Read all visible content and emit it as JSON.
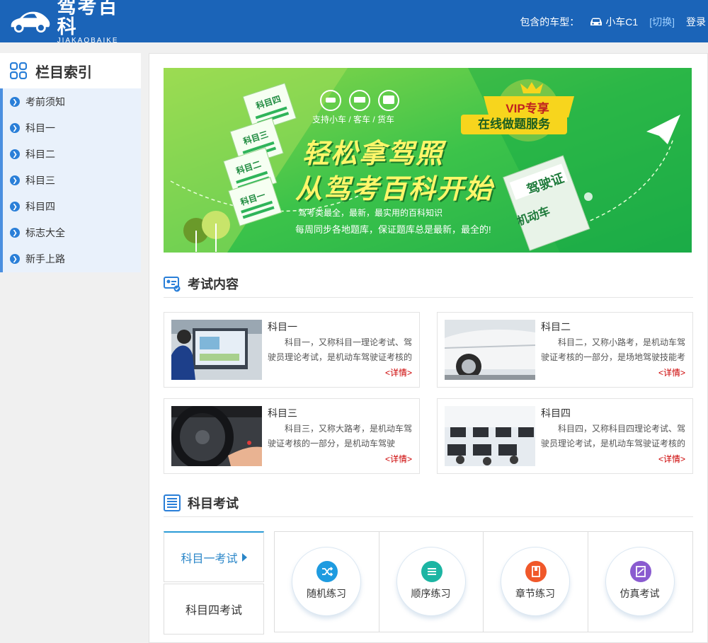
{
  "header": {
    "logo_title": "驾考百科",
    "logo_sub": "JIAKAOBAIKE",
    "car_type_label": "包含的车型：",
    "car_type_value": "小车C1",
    "switch_label": "[切换]",
    "login_label": "登录"
  },
  "sidebar": {
    "title": "栏目索引",
    "items": [
      {
        "label": "考前须知"
      },
      {
        "label": "科目一"
      },
      {
        "label": "科目二"
      },
      {
        "label": "科目三"
      },
      {
        "label": "科目四"
      },
      {
        "label": "标志大全"
      },
      {
        "label": "新手上路"
      }
    ]
  },
  "banner": {
    "support": "支持小车 / 客车 / 货车",
    "line1": "轻松拿驾照",
    "line2": "从驾考百科开始",
    "desc1": "驾考类最全，最新，最实用的百科知识",
    "desc2": "每周同步各地题库，保证题库总是最新，最全的!",
    "vip": "VIP专享",
    "online": "在线做题服务",
    "tickets": [
      "科目四",
      "科目三",
      "科目二",
      "科目一"
    ],
    "license_a": "驾驶证",
    "license_b": "机动车"
  },
  "exam_section": {
    "title": "考试内容",
    "cards": [
      {
        "title": "科目一",
        "desc": "科目一，又称科目一理论考试、驾驶员理论考试，是机动车驾驶证考核的",
        "more": "<详情>"
      },
      {
        "title": "科目二",
        "desc": "科目二，又称小路考，是机动车驾驶证考核的一部分，是场地驾驶技能考",
        "more": "<详情>"
      },
      {
        "title": "科目三",
        "desc": "科目三，又称大路考，是机动车驾驶证考核的一部分，是机动车驾驶",
        "more": "<详情>"
      },
      {
        "title": "科目四",
        "desc": "科目四，又称科目四理论考试、驾驶员理论考试，是机动车驾驶证考核的",
        "more": "<详情>"
      }
    ]
  },
  "subject_section": {
    "title": "科目考试",
    "tabs": [
      {
        "label": "科目一考试",
        "active": true
      },
      {
        "label": "科目四考试",
        "active": false
      }
    ],
    "practices": [
      {
        "label": "随机练习",
        "icon": "shuffle-icon",
        "color": "#1e9be0"
      },
      {
        "label": "顺序练习",
        "icon": "list-order-icon",
        "color": "#1cb5a3"
      },
      {
        "label": "章节练习",
        "icon": "book-icon",
        "color": "#f0582a"
      },
      {
        "label": "仿真考试",
        "icon": "exam-paper-icon",
        "color": "#8a5bd0"
      }
    ]
  },
  "colors": {
    "header_bg": "#1b64b8",
    "accent": "#2a86c8",
    "banner_green": "#3cc34a",
    "detail_red": "#cc0000"
  }
}
